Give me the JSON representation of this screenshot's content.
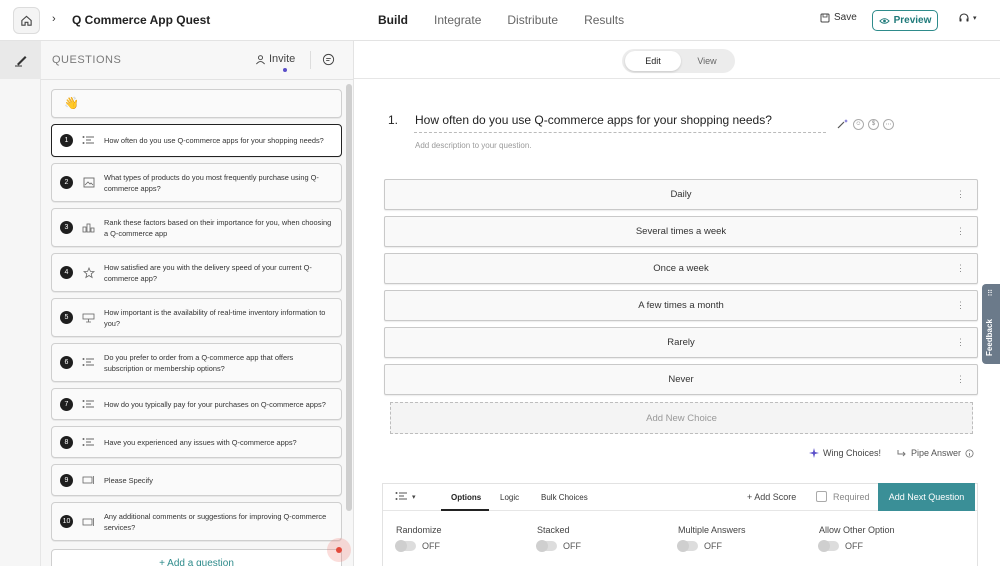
{
  "header": {
    "app_title": "Q Commerce App Quest",
    "nav_tabs": [
      {
        "label": "Build",
        "active": true
      },
      {
        "label": "Integrate",
        "active": false
      },
      {
        "label": "Distribute",
        "active": false
      },
      {
        "label": "Results",
        "active": false
      }
    ],
    "save_label": "Save",
    "preview_label": "Preview"
  },
  "questions_panel": {
    "heading": "QUESTIONS",
    "invite_label": "Invite",
    "add_question_label": "+ Add a question",
    "items": [
      {
        "num": "1",
        "icon": "multiple-choice-icon",
        "text": "How often do you use Q-commerce apps for your shopping needs?",
        "selected": true
      },
      {
        "num": "2",
        "icon": "picture-choice-icon",
        "text": "What types of products do you most frequently purchase using Q-commerce apps?"
      },
      {
        "num": "3",
        "icon": "ranking-icon",
        "text": "Rank these factors based on their importance for you, when choosing a Q-commerce app"
      },
      {
        "num": "4",
        "icon": "star-rating-icon",
        "text": "How satisfied are you with the delivery speed of your current Q-commerce app?"
      },
      {
        "num": "5",
        "icon": "scale-icon",
        "text": "How important is the availability of real-time inventory information to you?"
      },
      {
        "num": "6",
        "icon": "multiple-choice-icon",
        "text": "Do you prefer to order from a Q-commerce app that offers subscription or membership options?"
      },
      {
        "num": "7",
        "icon": "multiple-choice-icon",
        "text": "How do you typically pay for your purchases on Q-commerce apps?"
      },
      {
        "num": "8",
        "icon": "multiple-choice-icon",
        "text": "Have you experienced any issues with Q-commerce apps?"
      },
      {
        "num": "9",
        "icon": "text-input-icon",
        "text": "Please Specify"
      },
      {
        "num": "10",
        "icon": "text-input-icon",
        "text": "Any additional comments or suggestions for improving Q-commerce services?"
      }
    ]
  },
  "editor": {
    "mode_edit": "Edit",
    "mode_view": "View",
    "question_number": "1.",
    "question_title": "How often do you use Q-commerce apps for your shopping needs?",
    "description_placeholder": "Add description to your question.",
    "choices": [
      "Daily",
      "Several times a week",
      "Once a week",
      "A few times a month",
      "Rarely",
      "Never"
    ],
    "add_choice_label": "Add New Choice",
    "wing_choices_label": "Wing Choices!",
    "pipe_answer_label": "Pipe Answer"
  },
  "settings": {
    "tabs": [
      "Options",
      "Logic",
      "Bulk Choices"
    ],
    "active_tab": "Options",
    "add_score_label": "+ Add Score",
    "required_label": "Required",
    "next_question_label": "Add Next Question",
    "options": [
      {
        "label": "Randomize",
        "state": "OFF"
      },
      {
        "label": "Stacked",
        "state": "OFF"
      },
      {
        "label": "Multiple Answers",
        "state": "OFF"
      },
      {
        "label": "Allow Other Option",
        "state": "OFF"
      }
    ]
  },
  "feedback_label": "Feedback",
  "colors": {
    "accent": "#3a8f97",
    "preview_border": "#2e8b8b",
    "invite_dot": "#5a4fc9",
    "record_dot": "#e34a3c"
  }
}
